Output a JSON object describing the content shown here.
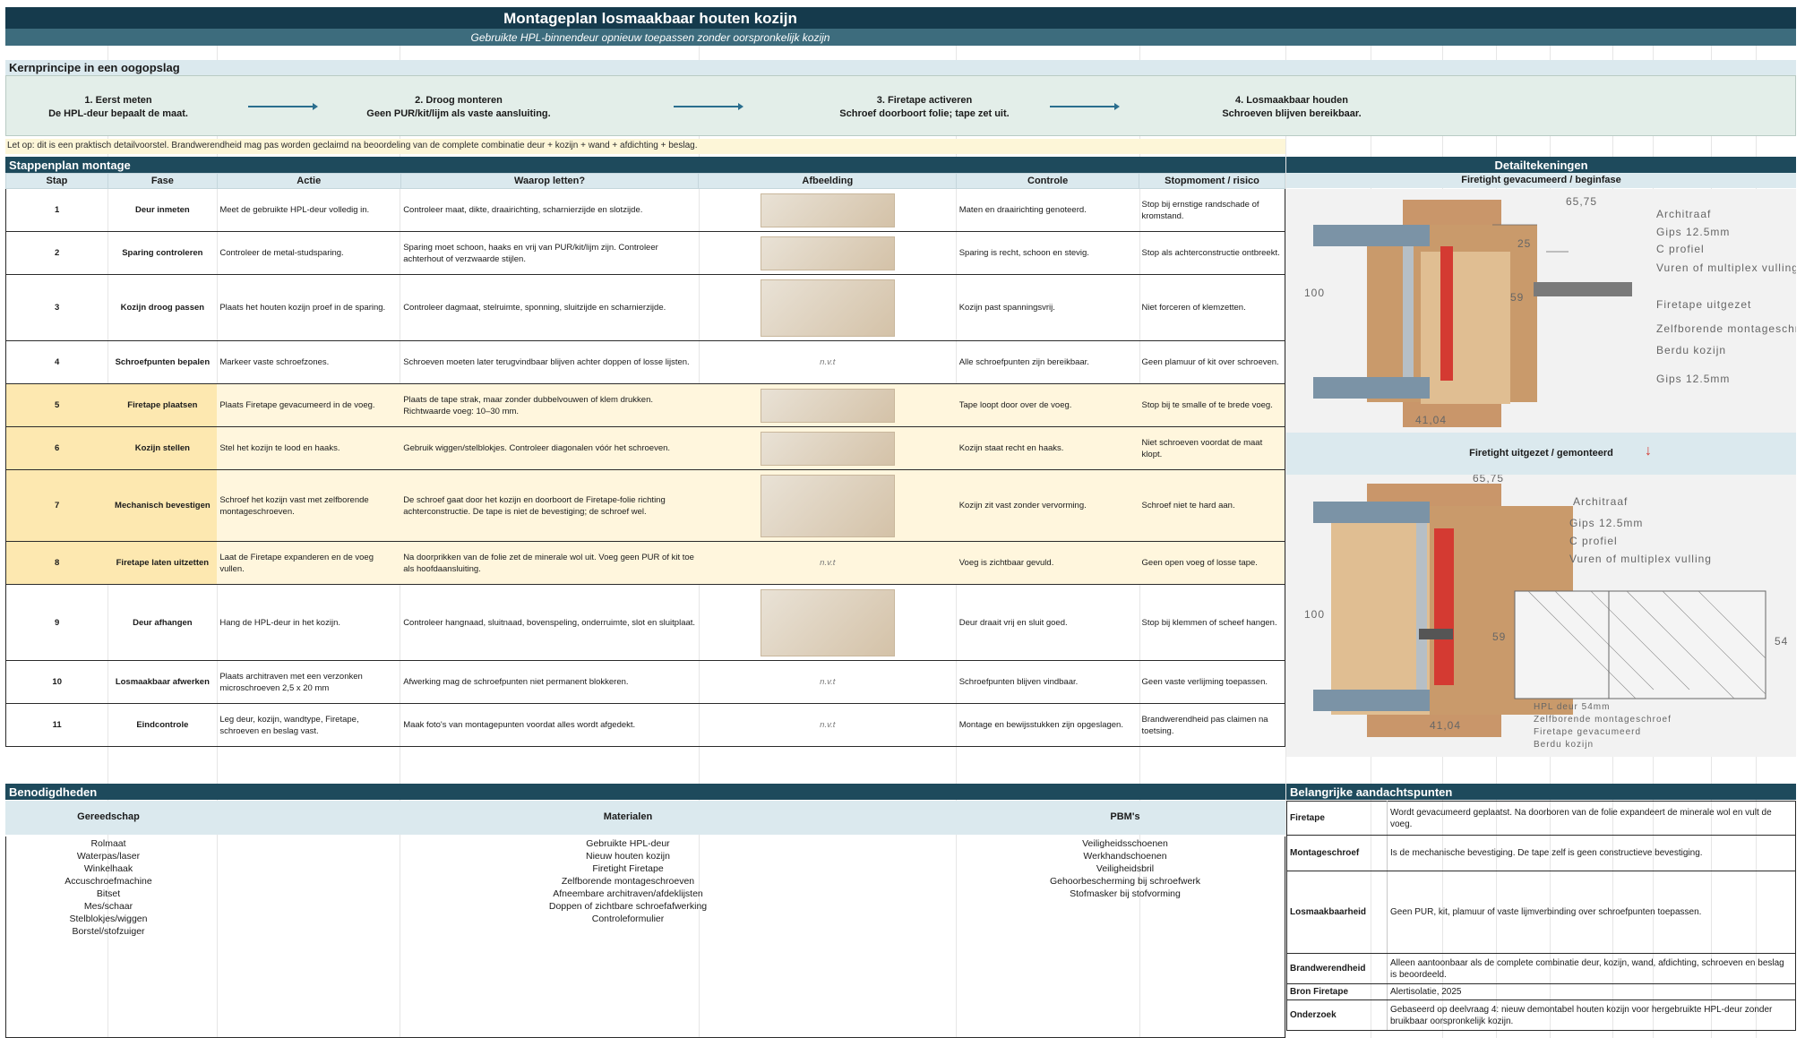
{
  "header": {
    "title": "Montageplan losmaakbaar houten kozijn",
    "subtitle": "Gebruikte HPL-binnendeur opnieuw toepassen zonder oorspronkelijk kozijn"
  },
  "principle": {
    "heading": "Kernprincipe in een oogopslag",
    "steps": [
      {
        "title": "1. Eerst meten",
        "text": "De HPL-deur bepaalt de maat."
      },
      {
        "title": "2. Droog monteren",
        "text": "Geen PUR/kit/lijm als vaste aansluiting."
      },
      {
        "title": "3. Firetape activeren",
        "text": "Schroef doorboort folie; tape zet uit."
      },
      {
        "title": "4. Losmaakbaar houden",
        "text": "Schroeven blijven bereikbaar."
      }
    ]
  },
  "note": "Let op: dit is een praktisch detailvoorstel. Brandwerendheid mag pas worden geclaimd na beoordeling van de complete combinatie deur + kozijn + wand + afdichting + beslag.",
  "steps_section": {
    "heading": "Stappenplan montage",
    "columns": [
      "Stap",
      "Fase",
      "Actie",
      "Waarop letten?",
      "Afbeelding",
      "Controle",
      "Stopmoment / risico"
    ],
    "rows": [
      {
        "stap": "1",
        "fase": "Deur inmeten",
        "actie": "Meet de gebruikte HPL-deur volledig in.",
        "letten": "Controleer maat, dikte, draairichting, scharnierzijde en slotzijde.",
        "afbeelding": "",
        "controle": "Maten en draairichting genoteerd.",
        "stop": "Stop bij ernstige randschade of kromstand."
      },
      {
        "stap": "2",
        "fase": "Sparing controleren",
        "actie": "Controleer de metal-studsparing.",
        "letten": "Sparing moet schoon, haaks en vrij van PUR/kit/lijm zijn. Controleer achterhout of verzwaarde stijlen.",
        "afbeelding": "",
        "controle": "Sparing is recht, schoon en stevig.",
        "stop": "Stop als achterconstructie ontbreekt."
      },
      {
        "stap": "3",
        "fase": "Kozijn droog passen",
        "actie": "Plaats het houten kozijn proef in de sparing.",
        "letten": "Controleer dagmaat, stelruimte, sponning, sluitzijde en scharnierzijde.",
        "afbeelding": "",
        "controle": "Kozijn past spanningsvrij.",
        "stop": "Niet forceren of klemzetten."
      },
      {
        "stap": "4",
        "fase": "Schroefpunten bepalen",
        "actie": "Markeer vaste schroefzones.",
        "letten": "Schroeven moeten later terugvindbaar blijven achter doppen of losse lijsten.",
        "afbeelding": "n.v.t",
        "controle": "Alle schroefpunten zijn bereikbaar.",
        "stop": "Geen plamuur of kit over schroeven."
      },
      {
        "stap": "5",
        "fase": "Firetape plaatsen",
        "actie": "Plaats Firetape gevacumeerd in de voeg.",
        "letten": "Plaats de tape strak, maar zonder dubbelvouwen of klem drukken. Richtwaarde voeg: 10–30 mm.",
        "afbeelding": "",
        "controle": "Tape loopt door over de voeg.",
        "stop": "Stop bij te smalle of te brede voeg."
      },
      {
        "stap": "6",
        "fase": "Kozijn stellen",
        "actie": "Stel het kozijn te lood en haaks.",
        "letten": "Gebruik wiggen/stelblokjes. Controleer diagonalen vóór het schroeven.",
        "afbeelding": "",
        "controle": "Kozijn staat recht en haaks.",
        "stop": "Niet schroeven voordat de maat klopt."
      },
      {
        "stap": "7",
        "fase": "Mechanisch bevestigen",
        "actie": "Schroef het kozijn vast met zelfborende montageschroeven.",
        "letten": "De schroef gaat door het kozijn en doorboort de Firetape-folie richting achterconstructie. De tape is niet de bevestiging; de schroef wel.",
        "afbeelding": "",
        "controle": "Kozijn zit vast zonder vervorming.",
        "stop": "Schroef niet te hard aan."
      },
      {
        "stap": "8",
        "fase": "Firetape laten uitzetten",
        "actie": "Laat de Firetape expanderen en de voeg vullen.",
        "letten": "Na doorprikken van de folie zet de minerale wol uit. Voeg geen PUR of kit toe als hoofdaansluiting.",
        "afbeelding": "n.v.t",
        "controle": "Voeg is zichtbaar gevuld.",
        "stop": "Geen open voeg of losse tape."
      },
      {
        "stap": "9",
        "fase": "Deur afhangen",
        "actie": "Hang de HPL-deur in het kozijn.",
        "letten": "Controleer hangnaad, sluitnaad, bovenspeling, onderruimte, slot en sluitplaat.",
        "afbeelding": "",
        "controle": "Deur draait vrij en sluit goed.",
        "stop": "Stop bij klemmen of scheef hangen."
      },
      {
        "stap": "10",
        "fase": "Losmaakbaar afwerken",
        "actie": "Plaats architraven met een verzonken microschroeven 2,5 x 20 mm",
        "letten": "Afwerking mag de schroefpunten niet permanent blokkeren.",
        "afbeelding": "n.v.t",
        "controle": "Schroefpunten blijven vindbaar.",
        "stop": "Geen vaste verlijming toepassen."
      },
      {
        "stap": "11",
        "fase": "Eindcontrole",
        "actie": "Leg deur, kozijn, wandtype, Firetape, schroeven en beslag vast.",
        "letten": "Maak foto's van montagepunten voordat alles wordt afgedekt.",
        "afbeelding": "n.v.t",
        "controle": "Montage en bewijsstukken zijn opgeslagen.",
        "stop": "Brandwerendheid pas claimen na toetsing."
      }
    ]
  },
  "details": {
    "heading": "Detailtekeningen",
    "top": {
      "caption": "Firetight gevacumeerd / beginfase",
      "dims": [
        "65,75",
        "25",
        "59",
        "100",
        "41,04"
      ],
      "labels": [
        "Architraaf",
        "Gips 12.5mm",
        "C profiel",
        "Vuren of multiplex vulling",
        "Firetape uitgezet",
        "Zelfborende montageschroef",
        "Berdu kozijn",
        "Gips 12.5mm"
      ]
    },
    "bottom": {
      "caption": "Firetight uitgezet / gemonteerd",
      "dims": [
        "65,75",
        "100",
        "59",
        "54",
        "41,04"
      ],
      "labels": [
        "Architraaf",
        "Gips 12.5mm",
        "C profiel",
        "Vuren of multiplex vulling",
        "HPL deur 54mm",
        "Zelfborende montageschroef",
        "Firetape gevacumeerd",
        "Berdu kozijn"
      ]
    }
  },
  "benodigdheden": {
    "heading": "Benodigdheden",
    "columns": [
      {
        "title": "Gereedschap",
        "items": [
          "Rolmaat",
          "Waterpas/laser",
          "Winkelhaak",
          "Accuschroefmachine",
          "Bitset",
          "Mes/schaar",
          "Stelblokjes/wiggen",
          "Borstel/stofzuiger"
        ]
      },
      {
        "title": "Materialen",
        "items": [
          "Gebruikte HPL-deur",
          "Nieuw houten kozijn",
          "Firetight Firetape",
          "Zelfborende montageschroeven",
          "Afneembare architraven/afdeklijsten",
          "Doppen of zichtbare schroefafwerking",
          "Controleformulier"
        ]
      },
      {
        "title": "PBM's",
        "items": [
          "Veiligheidsschoenen",
          "Werkhandschoenen",
          "Veiligheidsbril",
          "Gehoorbescherming bij schroefwerk",
          "Stofmasker bij stofvorming"
        ]
      }
    ]
  },
  "aandachtspunten": {
    "heading": "Belangrijke aandachtspunten",
    "rows": [
      {
        "key": "Firetape",
        "value": "Wordt gevacumeerd geplaatst. Na doorboren van de folie expandeert de minerale wol en vult de voeg."
      },
      {
        "key": "Montageschroef",
        "value": "Is de mechanische bevestiging. De tape zelf is geen constructieve bevestiging."
      },
      {
        "key": "Losmaakbaarheid",
        "value": "Geen PUR, kit, plamuur of vaste lijmverbinding over schroefpunten toepassen."
      },
      {
        "key": "Brandwerendheid",
        "value": "Alleen aantoonbaar als de complete combinatie deur, kozijn, wand, afdichting, schroeven en beslag is beoordeeld."
      },
      {
        "key": "Bron Firetape",
        "value": "Alertisolatie, 2025"
      },
      {
        "key": "Onderzoek",
        "value": "Gebaseerd op deelvraag 4: nieuw demontabel houten kozijn voor hergebruikte HPL-deur zonder bruikbaar oorspronkelijk kozijn."
      }
    ]
  },
  "colors": {
    "dark": "#153a4c",
    "mid": "#3d6c7d",
    "light": "#dbe9ee",
    "highlight": "#fde8b0",
    "firetape": "#d43a32"
  }
}
